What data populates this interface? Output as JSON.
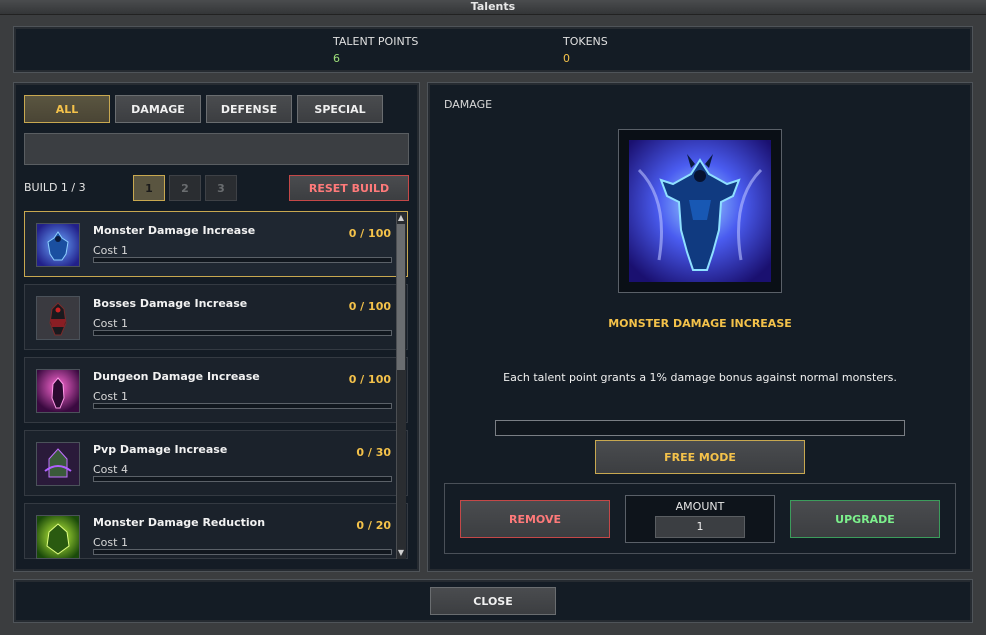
{
  "window": {
    "title": "Talents"
  },
  "stats": {
    "talent_points_label": "TALENT POINTS",
    "talent_points_value": "6",
    "tokens_label": "TOKENS",
    "tokens_value": "0"
  },
  "filters": [
    {
      "label": "ALL",
      "active": true
    },
    {
      "label": "DAMAGE",
      "active": false
    },
    {
      "label": "DEFENSE",
      "active": false
    },
    {
      "label": "SPECIAL",
      "active": false
    }
  ],
  "build": {
    "label": "BUILD 1 / 3",
    "pages": [
      "1",
      "2",
      "3"
    ],
    "reset_label": "RESET BUILD"
  },
  "talents": [
    {
      "name": "Monster Damage Increase",
      "level": "0 / 100",
      "cost": "Cost 1",
      "icon": "blue-demon-icon"
    },
    {
      "name": "Bosses Damage Increase",
      "level": "0 / 100",
      "cost": "Cost 1",
      "icon": "dark-knight-icon"
    },
    {
      "name": "Dungeon Damage Increase",
      "level": "0 / 100",
      "cost": "Cost 1",
      "icon": "magenta-warrior-icon"
    },
    {
      "name": "Pvp Damage Increase",
      "level": "0 / 30",
      "cost": "Cost 4",
      "icon": "purple-hooded-icon"
    },
    {
      "name": "Monster Damage Reduction",
      "level": "0 / 20",
      "cost": "Cost 1",
      "icon": "green-beast-icon"
    }
  ],
  "detail": {
    "category": "DAMAGE",
    "title": "MONSTER DAMAGE INCREASE",
    "description": "Each talent point grants a 1% damage bonus against normal monsters.",
    "free_mode_label": "FREE MODE",
    "remove_label": "REMOVE",
    "amount_label": "AMOUNT",
    "amount_value": "1",
    "upgrade_label": "UPGRADE"
  },
  "footer": {
    "close_label": "CLOSE"
  },
  "colors": {
    "accent_gold": "#f4c24a",
    "points_green": "#9ee07a",
    "remove_red": "#ff7a7a",
    "upgrade_green": "#7cf08c",
    "panel_bg": "#141c25"
  }
}
